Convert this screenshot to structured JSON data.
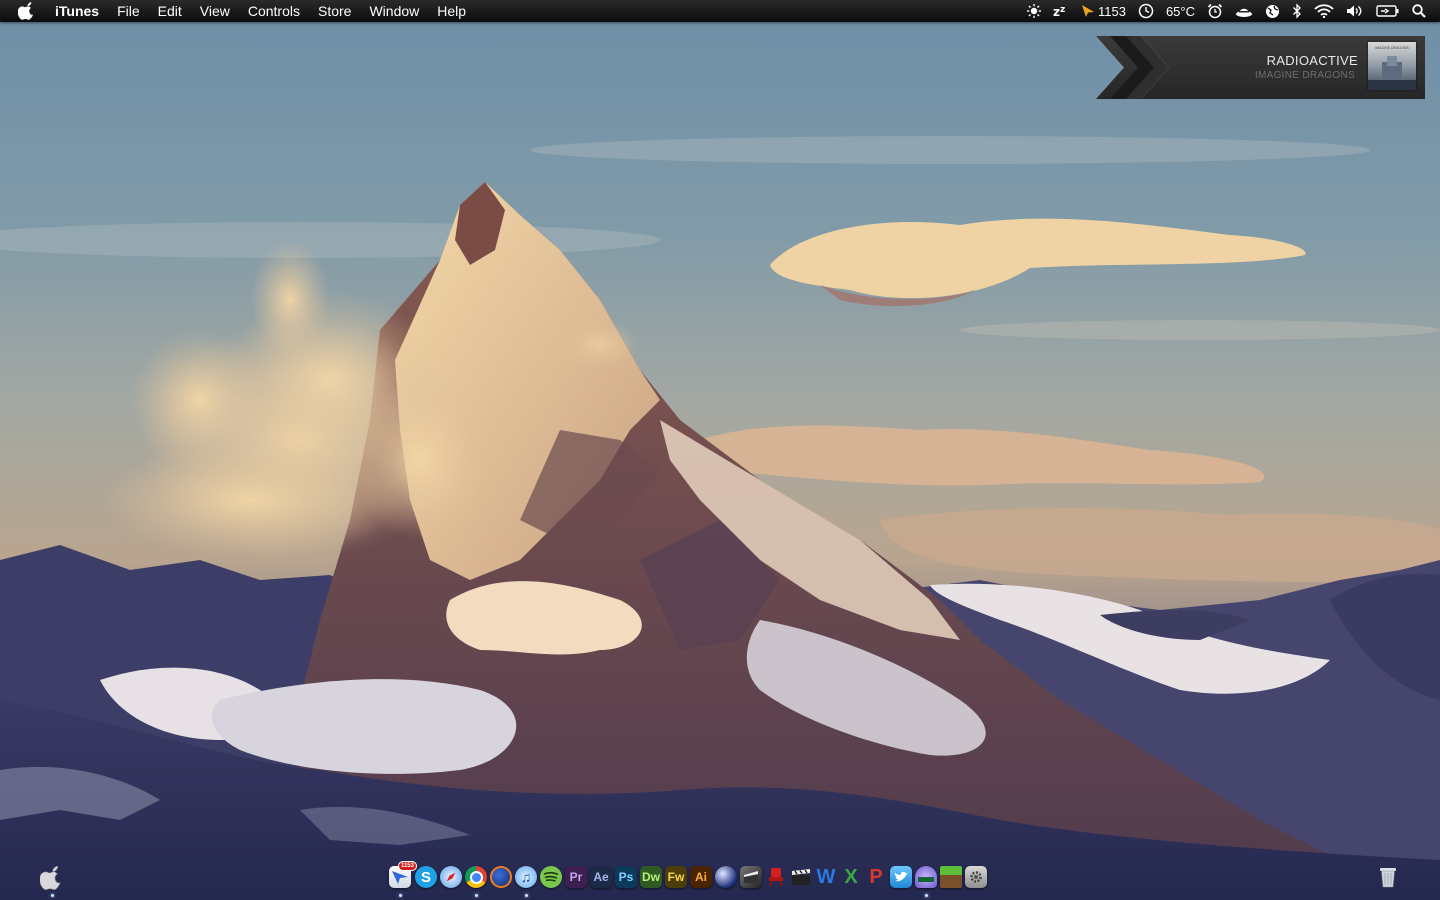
{
  "menubar": {
    "app_name": "iTunes",
    "menus": [
      "File",
      "Edit",
      "View",
      "Controls",
      "Store",
      "Window",
      "Help"
    ],
    "status_items": [
      {
        "icon": "brightness-icon"
      },
      {
        "icon": "caffeine-zz-icon"
      },
      {
        "icon": "sparrow-arrow-icon",
        "text": "1153"
      },
      {
        "icon": "time-machine-icon"
      },
      {
        "icon": "temperature-label",
        "text": "65°C"
      },
      {
        "icon": "alarm-clock-icon"
      },
      {
        "icon": "hat-icon"
      },
      {
        "icon": "globe-icon"
      },
      {
        "icon": "bluetooth-icon"
      },
      {
        "icon": "wifi-icon"
      },
      {
        "icon": "volume-icon"
      },
      {
        "icon": "battery-icon"
      },
      {
        "icon": "spotlight-search-icon"
      }
    ]
  },
  "now_playing": {
    "title": "RADIOACTIVE",
    "artist": "IMAGINE DRAGONS",
    "cover_label": "IMAGINE DRAGONS"
  },
  "dock": {
    "left_icon": "apple-finder-icon",
    "items": [
      {
        "name": "sparrow-mail",
        "label": "",
        "badge": "1153"
      },
      {
        "name": "skype",
        "label": "S"
      },
      {
        "name": "safari",
        "label": ""
      },
      {
        "name": "chrome",
        "label": ""
      },
      {
        "name": "firefox",
        "label": ""
      },
      {
        "name": "itunes",
        "label": "♫"
      },
      {
        "name": "spotify",
        "label": ""
      },
      {
        "name": "premiere",
        "label": "Pr"
      },
      {
        "name": "after-effects",
        "label": "Ae"
      },
      {
        "name": "photoshop",
        "label": "Ps"
      },
      {
        "name": "dreamweaver",
        "label": "Dw"
      },
      {
        "name": "fireworks",
        "label": "Fw"
      },
      {
        "name": "illustrator",
        "label": "Ai"
      },
      {
        "name": "cinema4d",
        "label": ""
      },
      {
        "name": "final-cut",
        "label": ""
      },
      {
        "name": "red-chair",
        "label": ""
      },
      {
        "name": "clapper",
        "label": ""
      },
      {
        "name": "word",
        "label": "W"
      },
      {
        "name": "excel",
        "label": "X"
      },
      {
        "name": "powerpoint",
        "label": "P"
      },
      {
        "name": "twitter",
        "label": ""
      },
      {
        "name": "network-monitor",
        "label": ""
      },
      {
        "name": "minecraft",
        "label": ""
      },
      {
        "name": "system-preferences",
        "label": ""
      }
    ],
    "trash_icon": "trash-icon"
  }
}
